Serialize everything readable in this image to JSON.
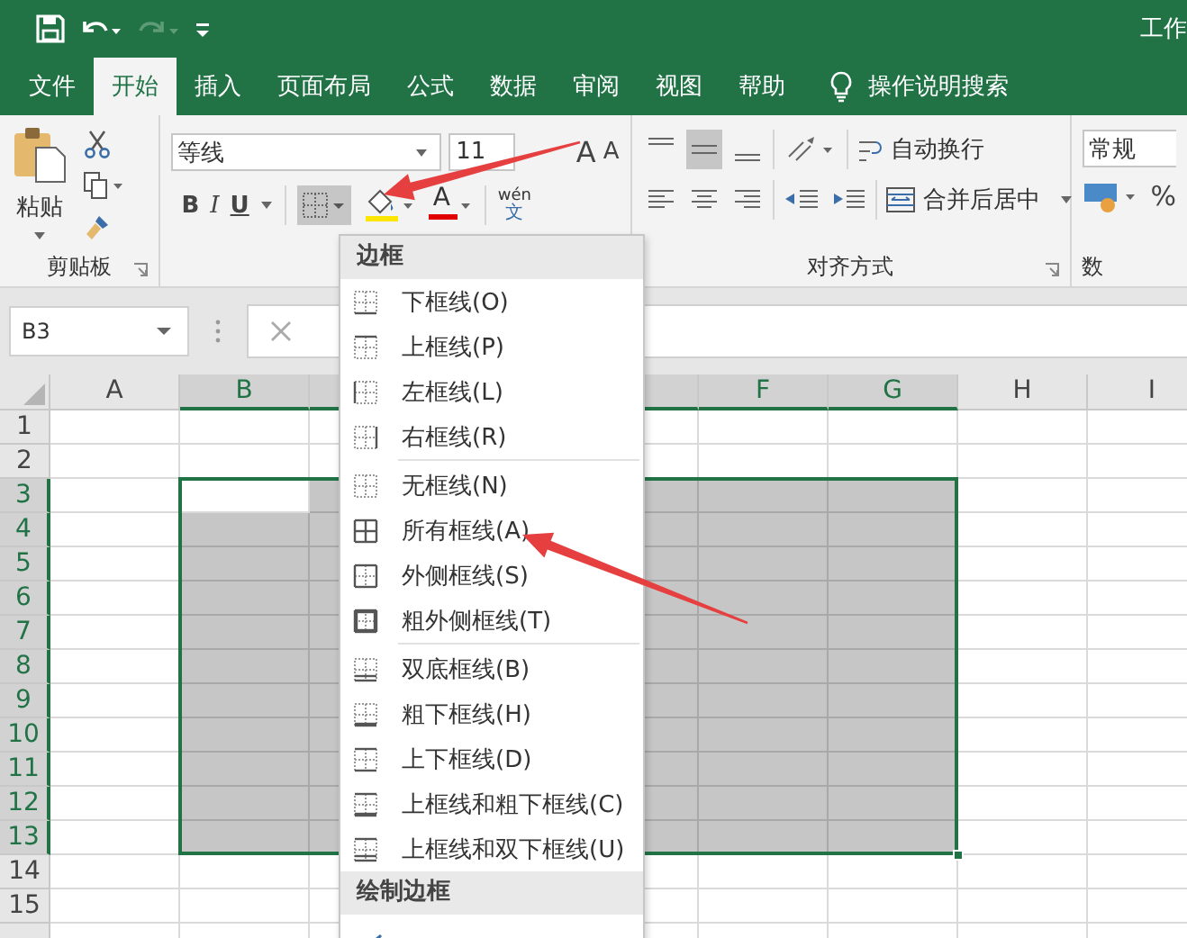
{
  "quick_access": {
    "redo": {
      "disabled": true
    }
  },
  "title": "工作",
  "tabs": [
    {
      "label": "文件",
      "selected": false
    },
    {
      "label": "开始",
      "selected": true
    },
    {
      "label": "插入",
      "selected": false
    },
    {
      "label": "页面布局",
      "selected": false
    },
    {
      "label": "公式",
      "selected": false
    },
    {
      "label": "数据",
      "selected": false
    },
    {
      "label": "审阅",
      "selected": false
    },
    {
      "label": "视图",
      "selected": false
    },
    {
      "label": "帮助",
      "selected": false
    }
  ],
  "tell_me": "操作说明搜索",
  "ribbon": {
    "clipboard": {
      "paste": "粘贴",
      "label": "剪贴板"
    },
    "font": {
      "name": "等线",
      "size": "11",
      "grow": "A",
      "shrink": "A",
      "bold": "B",
      "italic": "I",
      "underline": "U",
      "font_color": "A",
      "phonetic_top": "wén",
      "phonetic_bottom": "文",
      "border_pressed": true
    },
    "alignment": {
      "middle_selected": true,
      "wrap": "自动换行",
      "merge": "合并后居中",
      "label": "对齐方式"
    },
    "number": {
      "format": "常规",
      "percent": "%",
      "label": "数"
    }
  },
  "formula_bar": {
    "name_box": "B3"
  },
  "columns": [
    {
      "label": "A",
      "selected": false
    },
    {
      "label": "B",
      "selected": true
    },
    {
      "selected": true
    },
    {},
    {
      "selected": true
    },
    {
      "label": "F",
      "selected": true
    },
    {
      "label": "G",
      "selected": true
    },
    {
      "label": "H",
      "selected": false
    },
    {
      "label": "I",
      "selected": false
    }
  ],
  "rows": [
    {
      "label": "1",
      "selected": false
    },
    {
      "label": "2",
      "selected": false
    },
    {
      "label": "3",
      "selected": true
    },
    {
      "label": "4",
      "selected": true
    },
    {
      "label": "5",
      "selected": true
    },
    {
      "label": "6",
      "selected": true
    },
    {
      "label": "7",
      "selected": true
    },
    {
      "label": "8",
      "selected": true
    },
    {
      "label": "9",
      "selected": true
    },
    {
      "label": "10",
      "selected": true
    },
    {
      "label": "11",
      "selected": true
    },
    {
      "label": "12",
      "selected": true
    },
    {
      "label": "13",
      "selected": true
    },
    {
      "label": "14",
      "selected": false
    },
    {
      "label": "15",
      "selected": false
    },
    {
      "selected": false
    }
  ],
  "border_menu": {
    "sections": [
      {
        "title": "边框",
        "items": [
          {
            "kind": "item",
            "label": "下框线(O)"
          },
          {
            "kind": "item",
            "label": "上框线(P)"
          },
          {
            "kind": "item",
            "label": "左框线(L)"
          },
          {
            "kind": "item",
            "label": "右框线(R)"
          },
          {
            "kind": "separator"
          },
          {
            "kind": "item",
            "label": "无框线(N)"
          },
          {
            "kind": "item",
            "label": "所有框线(A)"
          },
          {
            "kind": "item",
            "label": "外侧框线(S)"
          },
          {
            "kind": "item",
            "label": "粗外侧框线(T)"
          },
          {
            "kind": "separator"
          },
          {
            "kind": "item",
            "label": "双底框线(B)"
          },
          {
            "kind": "item",
            "label": "粗下框线(H)"
          },
          {
            "kind": "item",
            "label": "上下框线(D)"
          },
          {
            "kind": "item",
            "label": "上框线和粗下框线(C)"
          },
          {
            "kind": "item",
            "label": "上框线和双下框线(U)"
          }
        ]
      },
      {
        "title": "绘制边框",
        "items": [
          {
            "kind": "cut"
          }
        ]
      }
    ]
  },
  "annotations": [
    {
      "kind": "arrow"
    },
    {
      "kind": "arrow"
    }
  ]
}
